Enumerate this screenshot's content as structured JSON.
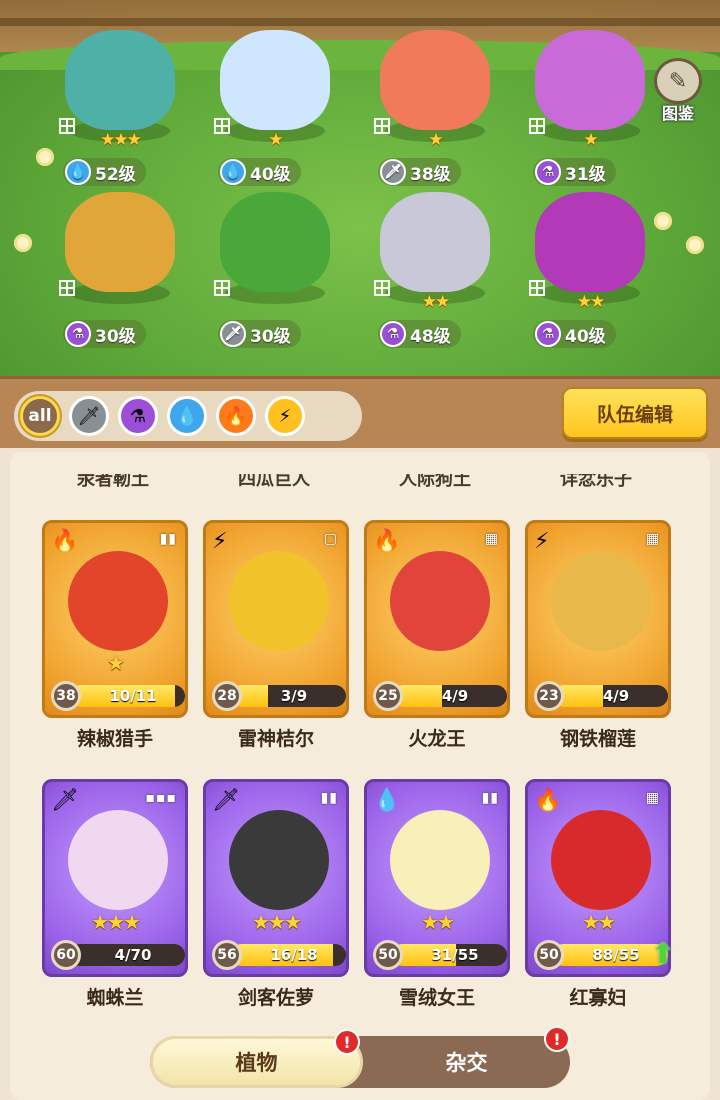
{
  "atlas": {
    "label": "图鉴",
    "icon": "book-icon"
  },
  "team_button": "队伍编辑",
  "filters": [
    {
      "key": "all",
      "label": "all",
      "icon": "all-icon"
    },
    {
      "key": "sword",
      "label": "🗡",
      "icon": "sword-icon"
    },
    {
      "key": "potion",
      "label": "⚗",
      "icon": "potion-icon"
    },
    {
      "key": "water",
      "label": "💧",
      "icon": "water-drop-icon"
    },
    {
      "key": "fire",
      "label": "🔥",
      "icon": "fire-icon"
    },
    {
      "key": "bolt",
      "label": "⚡",
      "icon": "lightning-icon"
    }
  ],
  "formation": [
    {
      "level": "52级",
      "element": "water",
      "element_glyph": "💧",
      "stars": "★★★",
      "color": "#4fb0a8"
    },
    {
      "level": "40级",
      "element": "water",
      "element_glyph": "💧",
      "stars": "★",
      "color": "#cfe6ff"
    },
    {
      "level": "38级",
      "element": "sword",
      "element_glyph": "🗡",
      "stars": "★",
      "color": "#f07a5a"
    },
    {
      "level": "31级",
      "element": "potion",
      "element_glyph": "⚗",
      "stars": "★",
      "color": "#c86ad8"
    },
    {
      "level": "30级",
      "element": "potion",
      "element_glyph": "⚗",
      "stars": "",
      "color": "#e0a63a"
    },
    {
      "level": "30级",
      "element": "sword",
      "element_glyph": "🗡",
      "stars": "",
      "color": "#4aa83a"
    },
    {
      "level": "48级",
      "element": "potion",
      "element_glyph": "⚗",
      "stars": "★★",
      "color": "#c8c8d8"
    },
    {
      "level": "40级",
      "element": "potion",
      "element_glyph": "⚗",
      "stars": "★★",
      "color": "#b23ab8"
    }
  ],
  "cut_names": [
    "汞者靭土",
    "四瓜巨人",
    "人际狗土",
    "详忿乐子"
  ],
  "cards": [
    {
      "name": "辣椒猎手",
      "level": "38",
      "progress_text": "10/11",
      "progress": 0.91,
      "stars": "★",
      "element_glyph": "🔥",
      "class_mark": "▮▮",
      "rarity": "gold",
      "color": "#e2452a"
    },
    {
      "name": "雷神桔尔",
      "level": "28",
      "progress_text": "3/9",
      "progress": 0.33,
      "stars": "",
      "element_glyph": "⚡",
      "class_mark": "▢",
      "rarity": "gold",
      "color": "#f2c22a"
    },
    {
      "name": "火龙王",
      "level": "25",
      "progress_text": "4/9",
      "progress": 0.44,
      "stars": "",
      "element_glyph": "🔥",
      "class_mark": "▦",
      "rarity": "gold",
      "color": "#e0443a"
    },
    {
      "name": "钢铁榴莲",
      "level": "23",
      "progress_text": "4/9",
      "progress": 0.44,
      "stars": "",
      "element_glyph": "⚡",
      "class_mark": "▦",
      "rarity": "gold",
      "color": "#e8b84a"
    },
    {
      "name": "蜘蛛兰",
      "level": "60",
      "progress_text": "4/70",
      "progress": 0.06,
      "stars": "★★★",
      "element_glyph": "🗡",
      "class_mark": "▪▪▪",
      "rarity": "purple",
      "color": "#f0d8f0"
    },
    {
      "name": "剑客佐萝",
      "level": "56",
      "progress_text": "16/18",
      "progress": 0.89,
      "stars": "★★★",
      "element_glyph": "🗡",
      "class_mark": "▮▮",
      "rarity": "purple",
      "color": "#3a3a3a"
    },
    {
      "name": "雪绒女王",
      "level": "50",
      "progress_text": "31/55",
      "progress": 0.56,
      "stars": "★★",
      "element_glyph": "💧",
      "class_mark": "▮▮",
      "rarity": "purple",
      "color": "#f8f0b8"
    },
    {
      "name": "红寡妇",
      "level": "50",
      "progress_text": "88/55",
      "progress": 1.0,
      "stars": "★★",
      "element_glyph": "🔥",
      "class_mark": "▦",
      "rarity": "purple",
      "color": "#d82a2a",
      "upgradable": true
    }
  ],
  "tabs": [
    {
      "label": "植物",
      "active": true,
      "badge": "!"
    },
    {
      "label": "杂交",
      "active": false,
      "badge": "!"
    }
  ]
}
